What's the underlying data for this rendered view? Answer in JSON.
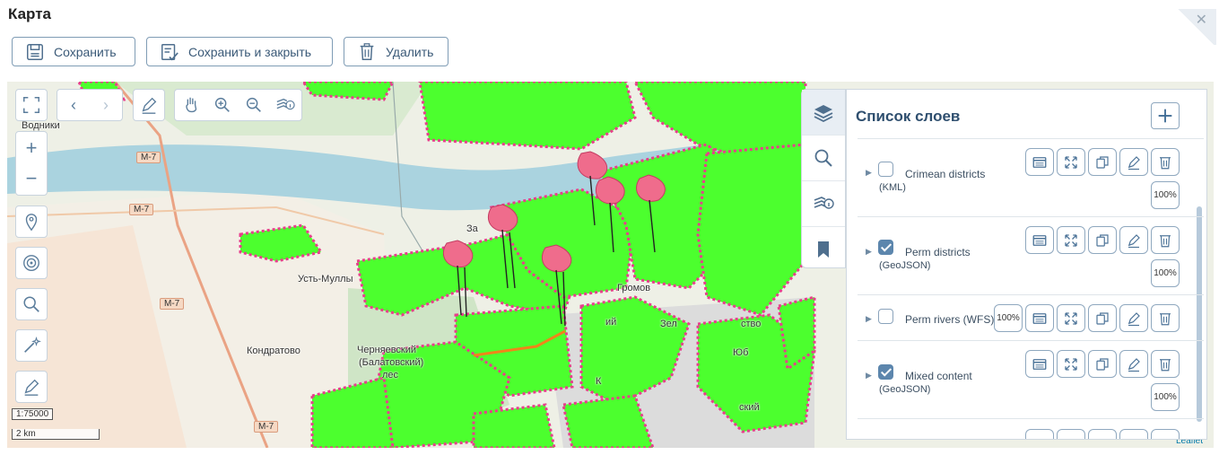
{
  "window": {
    "title": "Карта",
    "close": "✕"
  },
  "toolbar": {
    "save_label": "Сохранить",
    "save_close_label": "Сохранить и закрыть",
    "delete_label": "Удалить"
  },
  "map": {
    "place_labels": {
      "vodnik": "Водники",
      "ust_mully": "Усть-Муллы",
      "kondratovo": "Кондратово",
      "gromov": "Громов",
      "chernyaevsky": "Черняевский",
      "balatovsky": "(Балатовский)",
      "les": "лес",
      "zel": "Зел",
      "stvo": "ство",
      "yub": "Юб",
      "sky": "ский",
      "iy": "ий",
      "za": "За",
      "k": "К"
    },
    "road_labels": [
      "М-7",
      "М-7",
      "М-7",
      "М-7"
    ],
    "scale_ratio": "1:75000",
    "scale_distance": "2 km",
    "attribution": "Leaflet",
    "colors": {
      "polygon_fill": "#4cff2e",
      "polygon_border": "#e83e8c",
      "river": "#aad3df"
    }
  },
  "layers_panel": {
    "title": "Список слоев",
    "layers": [
      {
        "name": "Crimean districts",
        "sub": "(KML)",
        "checked": false,
        "opacity": "100%"
      },
      {
        "name": "Perm districts",
        "sub": "(GeoJSON)",
        "checked": true,
        "opacity": "100%"
      },
      {
        "name": "Perm rivers (WFS)",
        "sub": "",
        "checked": false,
        "opacity": "100%"
      },
      {
        "name": "Mixed content",
        "sub": "(GeoJSON)",
        "checked": true,
        "opacity": "100%"
      }
    ]
  }
}
